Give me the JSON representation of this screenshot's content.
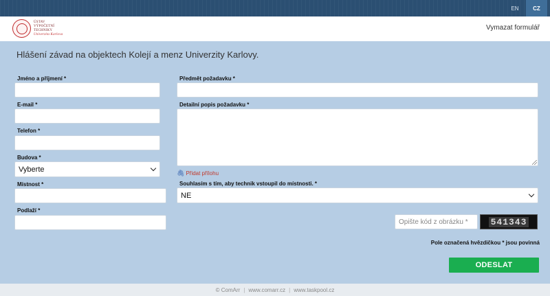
{
  "languages": {
    "en": "EN",
    "cz": "CZ"
  },
  "logo": {
    "line1": "ÚSTAV",
    "line2": "VÝPOČETNÍ",
    "line3": "TECHNIKY",
    "line4": "Univerzita Karlova"
  },
  "header": {
    "clear_form": "Vymazat formulář"
  },
  "page_title": "Hlášení závad na objektech Kolejí a menz Univerzity Karlovy.",
  "form": {
    "name_label": "Jméno a příjmení *",
    "email_label": "E-mail *",
    "phone_label": "Telefon *",
    "building_label": "Budova *",
    "building_value": "Vyberte",
    "room_label": "Místnost *",
    "floor_label": "Podlaží *",
    "subject_label": "Předmět požadavku *",
    "description_label": "Detailní popis požadavku *",
    "attach_label": "Přidat přílohu",
    "consent_label": "Souhlasím s tím, aby technik vstoupil do místnosti. *",
    "consent_value": "NE",
    "captcha_placeholder": "Opište kód z obrázku *",
    "captcha_code": "541343",
    "required_note": "Pole označená hvězdičkou * jsou povinná",
    "submit_label": "ODESLAT"
  },
  "footer": {
    "copyright": "© ComArr",
    "link1": "www.comarr.cz",
    "link2": "www.taskpool.cz"
  },
  "colors": {
    "topbar": "#2b4f72",
    "background": "#b6cde4",
    "submit": "#1aae50",
    "attach_link": "#c0392b"
  }
}
